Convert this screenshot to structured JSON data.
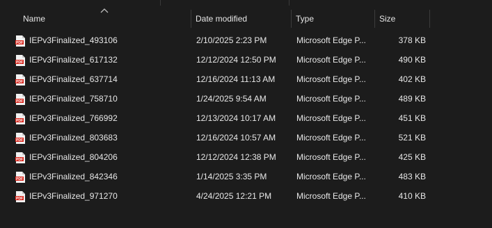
{
  "columns": {
    "name": "Name",
    "date": "Date modified",
    "type": "Type",
    "size": "Size"
  },
  "file_icon": "pdf-file-icon",
  "files": [
    {
      "name": "IEPv3Finalized_493106",
      "date": "2/10/2025 2:23 PM",
      "type": "Microsoft Edge P...",
      "size": "378 KB"
    },
    {
      "name": "IEPv3Finalized_617132",
      "date": "12/12/2024 12:50 PM",
      "type": "Microsoft Edge P...",
      "size": "490 KB"
    },
    {
      "name": "IEPv3Finalized_637714",
      "date": "12/16/2024 11:13 AM",
      "type": "Microsoft Edge P...",
      "size": "402 KB"
    },
    {
      "name": "IEPv3Finalized_758710",
      "date": "1/24/2025 9:54 AM",
      "type": "Microsoft Edge P...",
      "size": "489 KB"
    },
    {
      "name": "IEPv3Finalized_766992",
      "date": "12/13/2024 10:17 AM",
      "type": "Microsoft Edge P...",
      "size": "451 KB"
    },
    {
      "name": "IEPv3Finalized_803683",
      "date": "12/16/2024 10:57 AM",
      "type": "Microsoft Edge P...",
      "size": "521 KB"
    },
    {
      "name": "IEPv3Finalized_804206",
      "date": "12/12/2024 12:38 PM",
      "type": "Microsoft Edge P...",
      "size": "425 KB"
    },
    {
      "name": "IEPv3Finalized_842346",
      "date": "1/14/2025 3:35 PM",
      "type": "Microsoft Edge P...",
      "size": "483 KB"
    },
    {
      "name": "IEPv3Finalized_971270",
      "date": "4/24/2025 12:21 PM",
      "type": "Microsoft Edge P...",
      "size": "410 KB"
    }
  ]
}
